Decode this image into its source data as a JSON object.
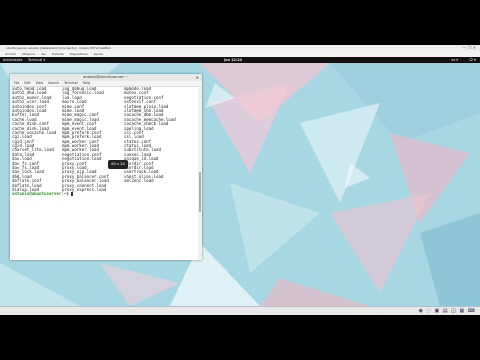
{
  "vbox": {
    "title": "ubuntu server ubuntu (instalacion) [Corriendo] - Oracle VM VirtualBox",
    "controls": "— ❐ ✕",
    "menu": [
      "Archivo",
      "Máquina",
      "Ver",
      "Entrada",
      "Dispositivos",
      "Ayuda"
    ]
  },
  "panel": {
    "activities": "Actividades",
    "app": "Terminal ▾",
    "clock": "jun 12:24",
    "lang": "es ▾",
    "tray": "⏻ ▾"
  },
  "terminal": {
    "title": "antonio@ubuntuserver: ~",
    "menu": [
      "File",
      "Edit",
      "View",
      "Search",
      "Terminal",
      "Help"
    ],
    "rows": [
      [
        "auto_head.load",
        "log_debug.load",
        "mpmode.load"
      ],
      [
        "authz_dbd.load",
        "log_forensic.load",
        "mutex.conf"
      ],
      [
        "authz_owner.load",
        "lua.load",
        "negotiation.conf"
      ],
      [
        "authz_user.load",
        "macro.load",
        "setenvif.conf"
      ],
      [
        "autoindex.conf",
        "mime.conf",
        "slotmem_plain.load"
      ],
      [
        "autoindex.load",
        "mime.load",
        "slotmem_shm.load"
      ],
      [
        "buffer.load",
        "mime_magic.conf",
        "socache_dbm.load"
      ],
      [
        "cache.load",
        "mime_magic.load",
        "socache_memcache.load"
      ],
      [
        "cache_disk.conf",
        "mpm_event.conf",
        "socache_shmcb.load"
      ],
      [
        "cache_disk.load",
        "mpm_event.load",
        "speling.load"
      ],
      [
        "cache_socache.load",
        "mpm_prefork.conf",
        "ssl.conf"
      ],
      [
        "cgi.load",
        "mpm_prefork.load",
        "ssl.load"
      ],
      [
        "cgid.conf",
        "mpm_worker.conf",
        "status.conf"
      ],
      [
        "cgid.load",
        "mpm_worker.load",
        "status.load"
      ],
      [
        "charset_lite.load",
        "mpm_worker.load",
        "substitute.load"
      ],
      [
        "data.load",
        "negotiation.conf",
        "suexec.load"
      ],
      [
        "dav.load",
        "negotiation.load",
        "unique_id.load"
      ],
      [
        "dav_fs.conf",
        "proxy.conf",
        "userdir.conf"
      ],
      [
        "dav_fs.load",
        "proxy.load",
        "userdir.load"
      ],
      [
        "dav_lock.load",
        "proxy_ajp.load",
        "usertrack.load"
      ],
      [
        "dbd.load",
        "proxy_balancer.conf",
        "vhost_alias.load"
      ],
      [
        "deflate.conf",
        "proxy_balancer.load",
        "xml2enc.load"
      ],
      [
        "deflate.load",
        "proxy_connect.load",
        ""
      ],
      [
        "dialup.load",
        "proxy_express.load",
        ""
      ]
    ],
    "prompt_user": "antonio@ubuntuserver",
    "prompt_rest": ":~$ ",
    "tooltip": "83 x 24"
  }
}
